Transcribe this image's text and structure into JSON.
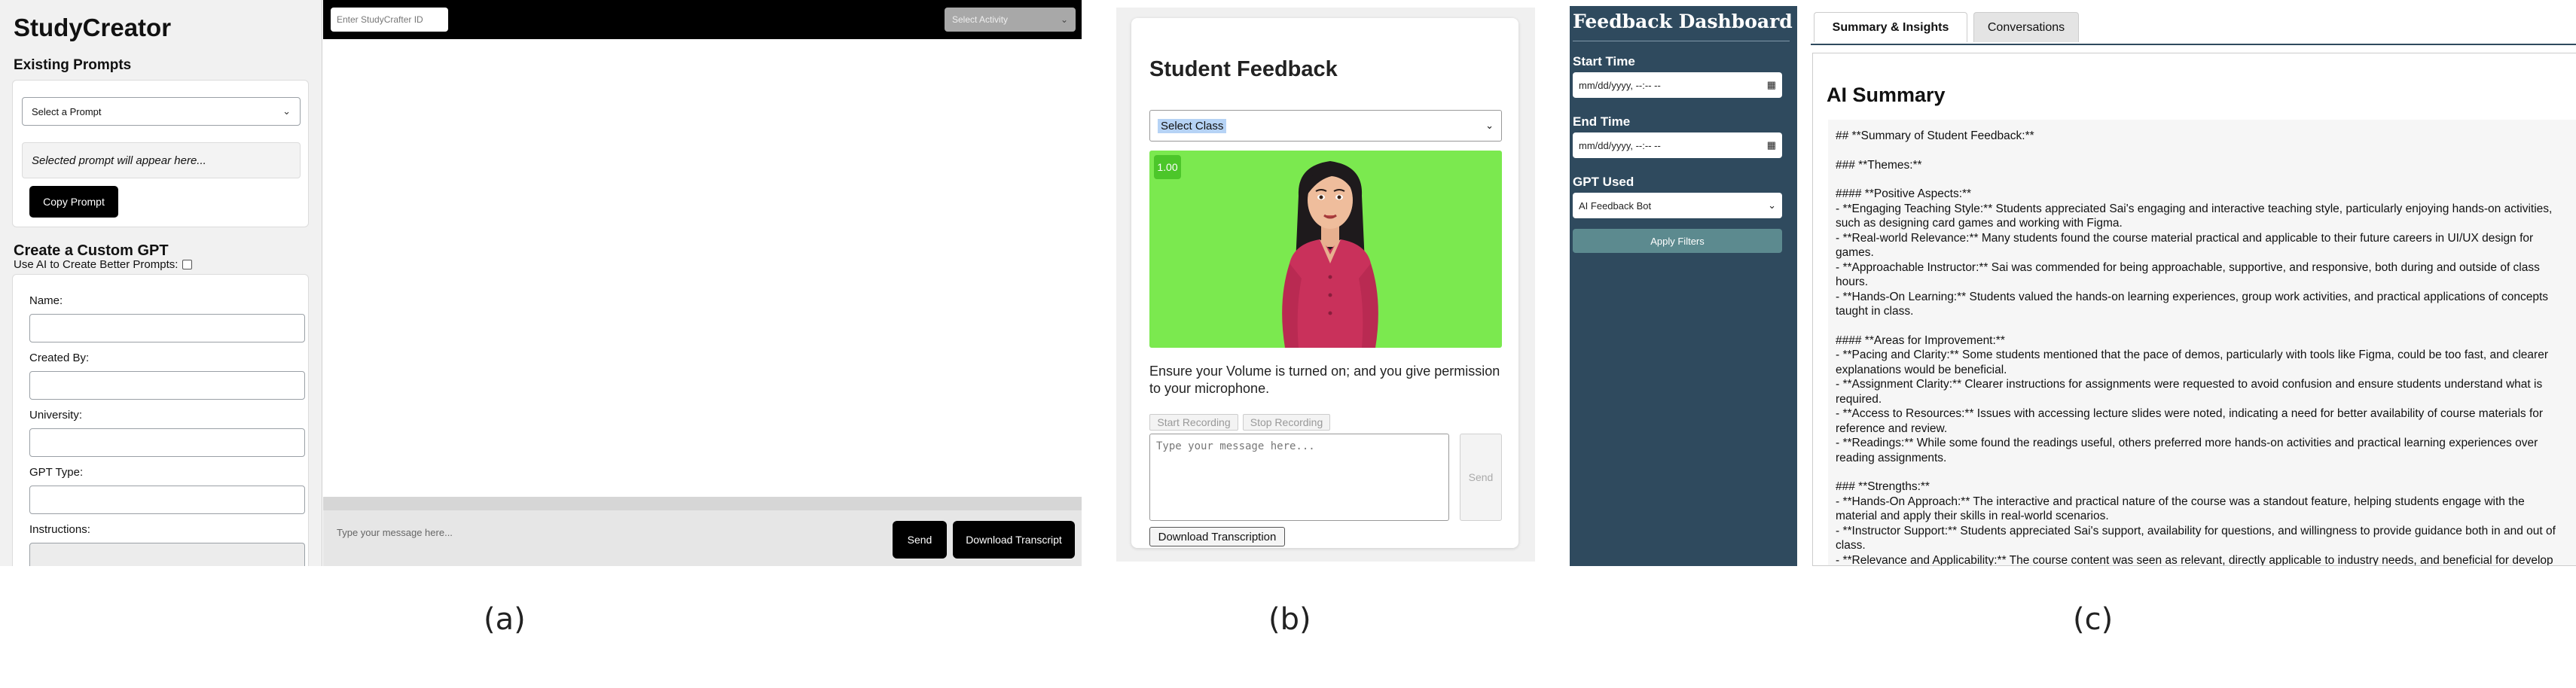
{
  "panel_a": {
    "app_title": "StudyCreator",
    "existing_prompts_heading": "Existing Prompts",
    "prompt_select_value": "Select a Prompt",
    "selected_prompt_placeholder": "Selected prompt will appear here...",
    "copy_button": "Copy Prompt",
    "create_heading": "Create a Custom GPT",
    "ai_checkbox_label": "Use AI to Create Better Prompts:",
    "fields": [
      "Name:",
      "Created By:",
      "University:",
      "GPT Type:",
      "Instructions:"
    ],
    "id_input_placeholder": "Enter StudyCrafter ID",
    "activity_select": "Select Activity",
    "message_placeholder": "Type your message here...",
    "send_button": "Send",
    "download_button": "Download Transcript"
  },
  "panel_b": {
    "title": "Student Feedback",
    "class_select": "Select Class",
    "playback_speed": "1.00",
    "instructions": "Ensure your Volume is turned on; and you give permission to your microphone.",
    "start_recording": "Start Recording",
    "stop_recording": "Stop Recording",
    "message_placeholder": "Type your message here...",
    "send_button": "Send",
    "download_button": "Download Transcription"
  },
  "panel_c": {
    "dashboard_title": "Feedback Dashboard",
    "start_time_label": "Start Time",
    "end_time_label": "End Time",
    "datetime_placeholder": "mm/dd/yyyy, --:-- --",
    "gpt_used_label": "GPT Used",
    "gpt_used_value": "AI Feedback Bot",
    "apply_filters": "Apply Filters",
    "tabs": [
      "Summary & Insights",
      "Conversations"
    ],
    "ai_summary_title": "AI Summary",
    "summary_blocks": [
      [
        "## **Summary of Student Feedback:**"
      ],
      [
        "### **Themes:**"
      ],
      [
        "#### **Positive Aspects:**",
        "- **Engaging Teaching Style:** Students appreciated Sai's engaging and interactive teaching style, particularly enjoying hands-on activities,",
        "such as designing card games and working with Figma.",
        "- **Real-world Relevance:** Many students found the course material practical and applicable to their future careers in UI/UX design for",
        "games.",
        "- **Approachable Instructor:** Sai was commended for being approachable, supportive, and responsive, both during and outside of class",
        "hours.",
        "- **Hands-On Learning:** Students valued the hands-on learning experiences, group work activities, and practical applications of concepts",
        "taught in class."
      ],
      [
        "#### **Areas for Improvement:**",
        "- **Pacing and Clarity:** Some students mentioned that the pace of demos, particularly with tools like Figma, could be too fast, and clearer",
        "explanations would be beneficial.",
        "- **Assignment Clarity:** Clearer instructions for assignments were requested to avoid confusion and ensure students understand what is",
        "required.",
        "- **Access to Resources:** Issues with accessing lecture slides were noted, indicating a need for better availability of course materials for",
        "reference and review.",
        "- **Readings:** While some found the readings useful, others preferred more hands-on activities and practical learning experiences over",
        "reading assignments."
      ],
      [
        "### **Strengths:**",
        "- **Hands-On Approach:** The interactive and practical nature of the course was a standout feature, helping students engage with the",
        "material and apply their skills in real-world scenarios.",
        "- **Instructor Support:** Students appreciated Sai's support, availability for questions, and willingness to provide guidance both in and out of",
        "class.",
        "- **Relevance and Applicability:** The course content was seen as relevant, directly applicable to industry needs, and beneficial for develop"
      ]
    ]
  },
  "captions": [
    "(a)",
    "(b)",
    "(c)"
  ]
}
